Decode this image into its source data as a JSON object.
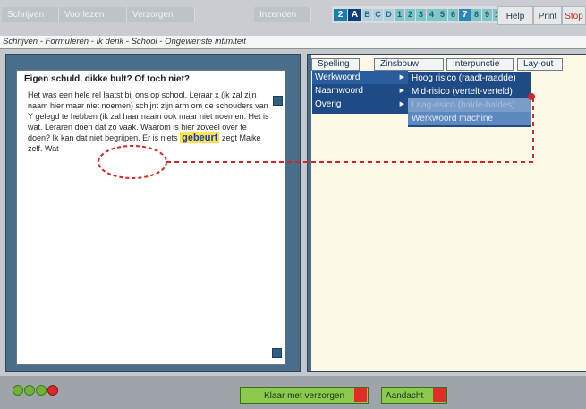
{
  "nav": {
    "tabs": [
      "Schrijven",
      "Voorlezen",
      "Verzorgen",
      "Inzenden"
    ]
  },
  "levels": [
    "2",
    "A",
    "B",
    "C",
    "D",
    "1",
    "2",
    "3",
    "4",
    "5",
    "6",
    "7",
    "8",
    "9",
    "10"
  ],
  "utility": {
    "help": "Help",
    "print": "Print",
    "stop": "Stop"
  },
  "breadcrumb": "Schrijven - Formuleren - Ik denk - School - Ongewenste intimiteit",
  "article": {
    "title": "Eigen schuld, dikke bult? Of toch niet?",
    "body_before": "Het was een hele rel laatst bij ons op school. Leraar x (ik zal zijn naam hier maar niet noemen) schijnt zijn arm om de schouders van Y gelegd te hebben (ik zal haar naam ook maar niet noemen. Het is wat. Leraren doen dat zo vaak. Waarom is hier zoveel over te doen? Ik kan dat niet begrijpen. Er is niets",
    "highlight": "gebeurt",
    "body_after": "zegt Maike zelf. Wat"
  },
  "categories": {
    "tabs": [
      "Spelling",
      "Zinsbouw",
      "Interpunctie",
      "Lay-out"
    ],
    "menu": [
      "Werkwoord",
      "Naamwoord",
      "Overig"
    ],
    "submenu": [
      "Hoog risico (raadt-raadde)",
      "Mid-risico (vertelt-verteld)",
      "Laag-risico (balde-baldes)",
      "Werkwoord machine"
    ]
  },
  "bottom": {
    "klaar": "Klaar met verzorgen",
    "aandacht": "Aandacht"
  },
  "colors": {
    "panel_blue": "#4a6e8a",
    "menu_blue": "#1e4a86",
    "highlight": "#ffe44d",
    "annotation": "#d42525",
    "button_green": "#8cc94c"
  }
}
